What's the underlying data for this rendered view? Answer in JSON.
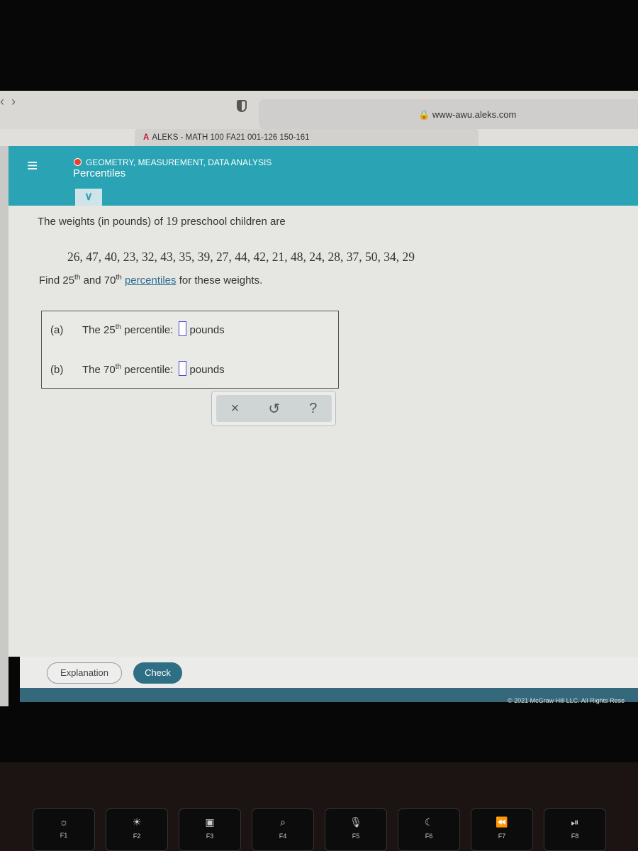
{
  "browser": {
    "url": "www-awu.aleks.com",
    "tab_title": "ALEKS - MATH 100 FA21 001-126 150-161"
  },
  "header": {
    "topic": "GEOMETRY, MEASUREMENT, DATA ANALYSIS",
    "subtopic": "Percentiles",
    "topic_status_color": "#e8412c",
    "accent": "#2aa3b4"
  },
  "question": {
    "intro_a": "The weights (in pounds) of",
    "count": "19",
    "intro_b": "preschool children are",
    "data": "26, 47, 40, 23, 32, 43, 35, 39, 27, 44, 42, 21, 48, 24, 28, 37, 50, 34, 29",
    "find": "Find",
    "p1": "25",
    "th": "th",
    "and": "and",
    "p2": "70",
    "link": "percentiles",
    "tail": "for these weights."
  },
  "answers": [
    {
      "label": "(a)",
      "text_a": "The",
      "num": "25",
      "sup": "th",
      "text_b": "percentile:",
      "value": "",
      "unit": "pounds"
    },
    {
      "label": "(b)",
      "text_a": "The",
      "num": "70",
      "sup": "th",
      "text_b": "percentile:",
      "value": "",
      "unit": "pounds"
    }
  ],
  "tools": {
    "clear": "×",
    "undo": "↺",
    "help": "?"
  },
  "buttons": {
    "explanation": "Explanation",
    "check": "Check"
  },
  "footer": {
    "copyright": "© 2021 McGraw Hill LLC. All Rights Rese"
  },
  "keys": [
    {
      "icon": "☼",
      "label": "F1"
    },
    {
      "icon": "☀",
      "label": "F2"
    },
    {
      "icon": "▣",
      "label": "F3"
    },
    {
      "icon": "⌕",
      "label": "F4"
    },
    {
      "icon": "🎙",
      "label": "F5"
    },
    {
      "icon": "☾",
      "label": "F6"
    },
    {
      "icon": "⏪",
      "label": "F7"
    },
    {
      "icon": "⏯",
      "label": "F8"
    }
  ]
}
